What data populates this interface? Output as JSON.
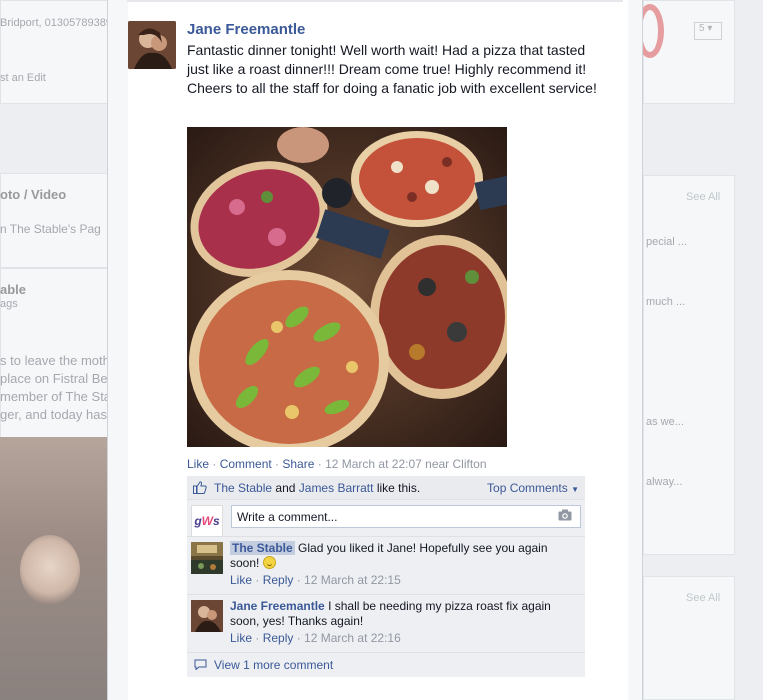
{
  "background": {
    "address_snippet": "Bridport, 01305789389",
    "edit_link": "st an Edit",
    "photo_video_label": "oto / Video",
    "page_input_placeholder": "n The Stable's Pag",
    "page_name_snippet": "able",
    "page_meta_snippet": "ags",
    "post_lines": [
      "s to leave the moth",
      "place on Fistral Be",
      "member of The Sta",
      "ger, and today has"
    ],
    "see_all_top": "See All",
    "see_all_bottom": "See All",
    "right_snippets": [
      "pecial ...",
      "much ...",
      "as we...",
      "alway..."
    ],
    "select_value": "5"
  },
  "post": {
    "author": "Jane Freemantle",
    "text": "Fantastic dinner tonight! Well worth wait! Had a pizza that tasted just like a roast dinner!!! Dream come true! Highly recommend it! Cheers to all the staff for doing a fanatic job with excellent service!",
    "actions": {
      "like": "Like",
      "comment": "Comment",
      "share": "Share",
      "timestamp": "12 March at 22:07 near Clifton"
    }
  },
  "likes": {
    "name1": "The Stable",
    "and": "and",
    "name2": "James Barratt",
    "suffix": "like this.",
    "top_comments": "Top Comments"
  },
  "comment_input": {
    "placeholder": "Write a comment..."
  },
  "comments": [
    {
      "author": "The Stable",
      "text": "Glad you liked it Jane! Hopefully see you again soon!",
      "like": "Like",
      "reply": "Reply",
      "timestamp": "12 March at 22:15"
    },
    {
      "author": "Jane Freemantle",
      "text": "I shall be needing my pizza roast fix again soon, yes! Thanks again!",
      "like": "Like",
      "reply": "Reply",
      "timestamp": "12 March at 22:16"
    }
  ],
  "view_more": "View 1 more comment",
  "colors": {
    "link": "#3b5998",
    "meta": "#9197a3",
    "ufi_bg": "#edeff2"
  }
}
